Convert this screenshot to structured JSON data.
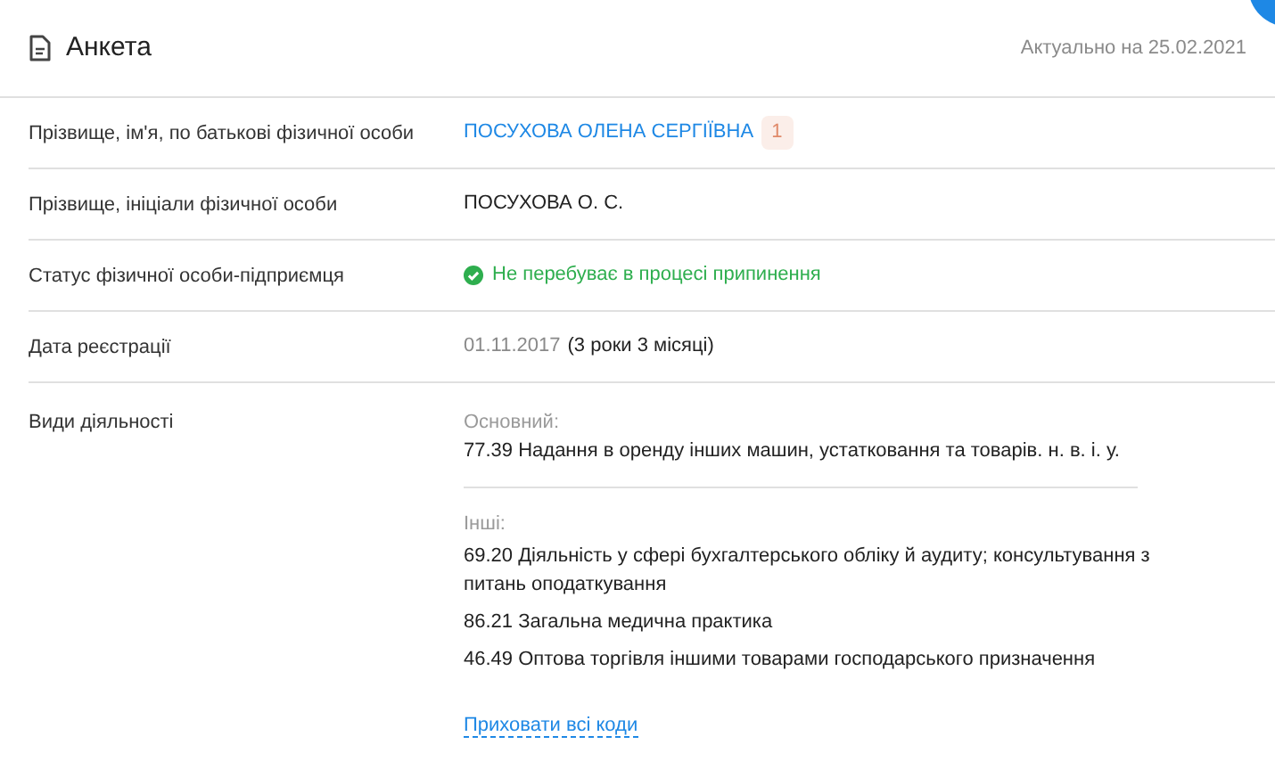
{
  "header": {
    "title": "Анкета",
    "updated": "Актуально на 25.02.2021"
  },
  "rows": [
    {
      "kind": "link",
      "label": "Прізвище, ім'я, по батькові фізичної особи",
      "value": "ПОСУХОВА ОЛЕНА СЕРГІЇВНА",
      "badge": "1"
    },
    {
      "kind": "plain",
      "label": "Прізвище, ініціали фізичної особи",
      "value": "ПОСУХОВА О. С."
    },
    {
      "kind": "status",
      "label": "Статус фізичної особи-підприємця",
      "value": "Не перебуває в процесі припинення"
    },
    {
      "kind": "date",
      "label": "Дата реєстрації",
      "date": "01.11.2017",
      "value": "(3 роки 3 місяці)"
    },
    {
      "kind": "activities",
      "label": "Види діяльності",
      "main_heading": "Основний:",
      "main": [
        "77.39 Надання в оренду інших машин, устатковання та товарів. н. в. і. у."
      ],
      "other_heading": "Інші:",
      "other": [
        "69.20 Діяльність у сфері бухгалтерського обліку й аудиту; консультування з питань оподаткування",
        "86.21 Загальна медична практика",
        "46.49 Оптова торгівля іншими товарами господарського призначення"
      ],
      "toggle": "Приховати всі коди"
    }
  ]
}
